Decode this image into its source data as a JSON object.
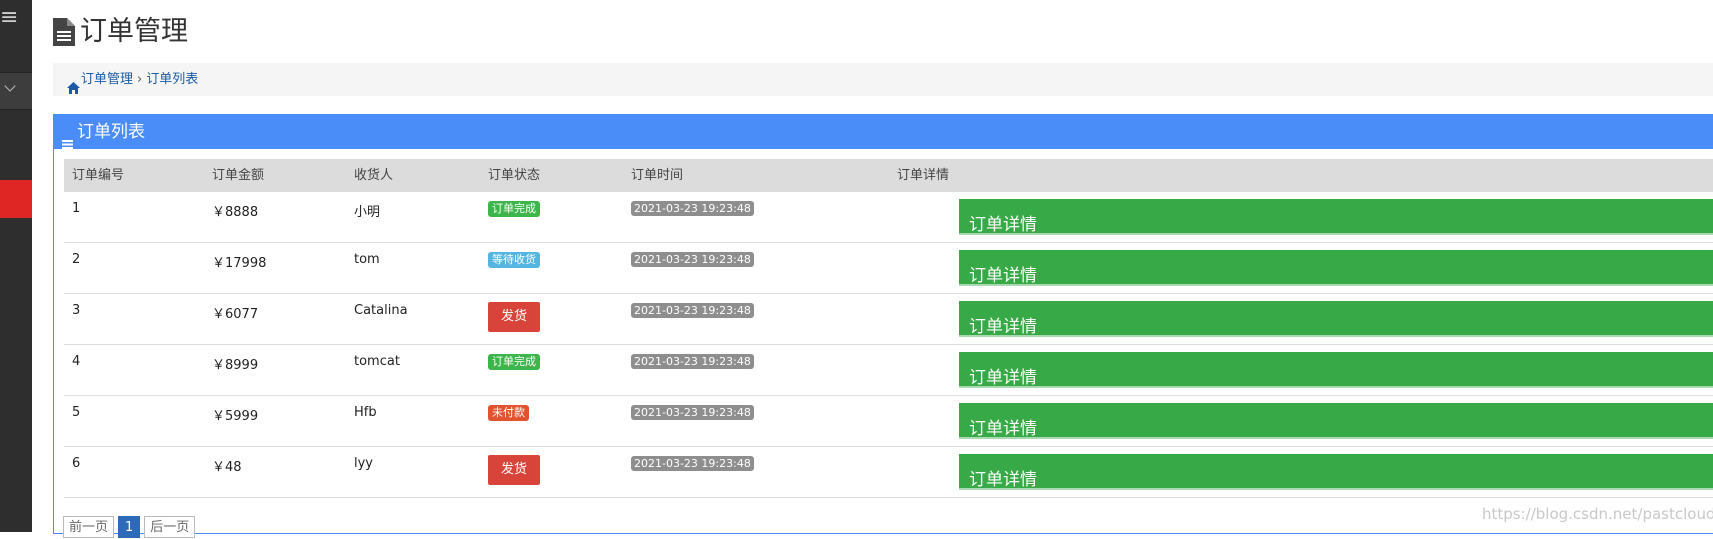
{
  "page": {
    "title": "订单管理"
  },
  "breadcrumb": {
    "home": "订单管理",
    "separator": "›",
    "current": "订单列表"
  },
  "panel": {
    "title": "订单列表"
  },
  "table": {
    "headers": [
      "订单编号",
      "订单金额",
      "收货人",
      "订单状态",
      "订单时间",
      "订单详情"
    ],
    "rows": [
      {
        "id": "1",
        "amount": "￥8888",
        "receiver": "小明",
        "status": "订单完成",
        "status_type": "badge",
        "status_color": "#3cb54a",
        "time": "2021-03-23 19:23:48",
        "detail": "订单详情"
      },
      {
        "id": "2",
        "amount": "￥17998",
        "receiver": "tom",
        "status": "等待收货",
        "status_type": "badge",
        "status_color": "#54b6e0",
        "time": "2021-03-23 19:23:48",
        "detail": "订单详情"
      },
      {
        "id": "3",
        "amount": "￥6077",
        "receiver": "Catalina",
        "status": "发货",
        "status_type": "button",
        "status_color": "#d9443a",
        "time": "2021-03-23 19:23:48",
        "detail": "订单详情"
      },
      {
        "id": "4",
        "amount": "￥8999",
        "receiver": "tomcat",
        "status": "订单完成",
        "status_type": "badge",
        "status_color": "#3cb54a",
        "time": "2021-03-23 19:23:48",
        "detail": "订单详情"
      },
      {
        "id": "5",
        "amount": "￥5999",
        "receiver": "Hfb",
        "status": "未付款",
        "status_type": "badge",
        "status_color": "#e2522e",
        "time": "2021-03-23 19:23:48",
        "detail": "订单详情"
      },
      {
        "id": "6",
        "amount": "￥48",
        "receiver": "lyy",
        "status": "发货",
        "status_type": "button",
        "status_color": "#d9443a",
        "time": "2021-03-23 19:23:48",
        "detail": "订单详情"
      }
    ]
  },
  "pager": {
    "prev": "前一页",
    "current": "1",
    "next": "后一页"
  },
  "watermark": "https://blog.csdn.net/pastclouds",
  "colors": {
    "accent": "#4a8df8",
    "detail_green": "#37a947",
    "sidebar": "#2e2e2e",
    "sidebar_active": "#e02525"
  },
  "icons": {
    "title": "file-text-icon",
    "breadcrumb": "home-icon",
    "panel": "bars-icon",
    "detail": "caret-down-icon"
  }
}
